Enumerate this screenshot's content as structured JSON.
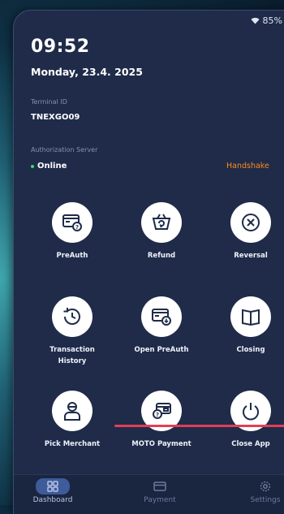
{
  "status_bar": {
    "battery": "85%"
  },
  "clock": {
    "time": "09:52",
    "date": "Monday, 23.4. 2025"
  },
  "terminal": {
    "label": "Terminal ID",
    "value": "TNEXGO09"
  },
  "auth_server": {
    "label": "Authorization Server",
    "status": "Online",
    "handshake": "Handshake"
  },
  "tiles": [
    {
      "label": "PreAuth",
      "icon": "preauth-card-icon"
    },
    {
      "label": "Refund",
      "icon": "refund-basket-icon"
    },
    {
      "label": "Reversal",
      "icon": "reversal-x-icon"
    },
    {
      "label": "Transaction History",
      "icon": "history-clock-icon"
    },
    {
      "label": "Open PreAuth",
      "icon": "open-preauth-card-icon"
    },
    {
      "label": "Closing",
      "icon": "closing-book-icon"
    },
    {
      "label": "Pick Merchant",
      "icon": "merchant-person-icon"
    },
    {
      "label": "MOTO Payment",
      "icon": "moto-payment-icon"
    },
    {
      "label": "Close App",
      "icon": "power-icon"
    }
  ],
  "nav": [
    {
      "label": "Dashboard",
      "active": true
    },
    {
      "label": "Payment",
      "active": false
    },
    {
      "label": "Settings",
      "active": false
    }
  ],
  "colors": {
    "background": "#1f2b49",
    "accent_orange": "#ff8a1a",
    "online_green": "#2ee06b",
    "annotation_red": "#e43e56"
  }
}
